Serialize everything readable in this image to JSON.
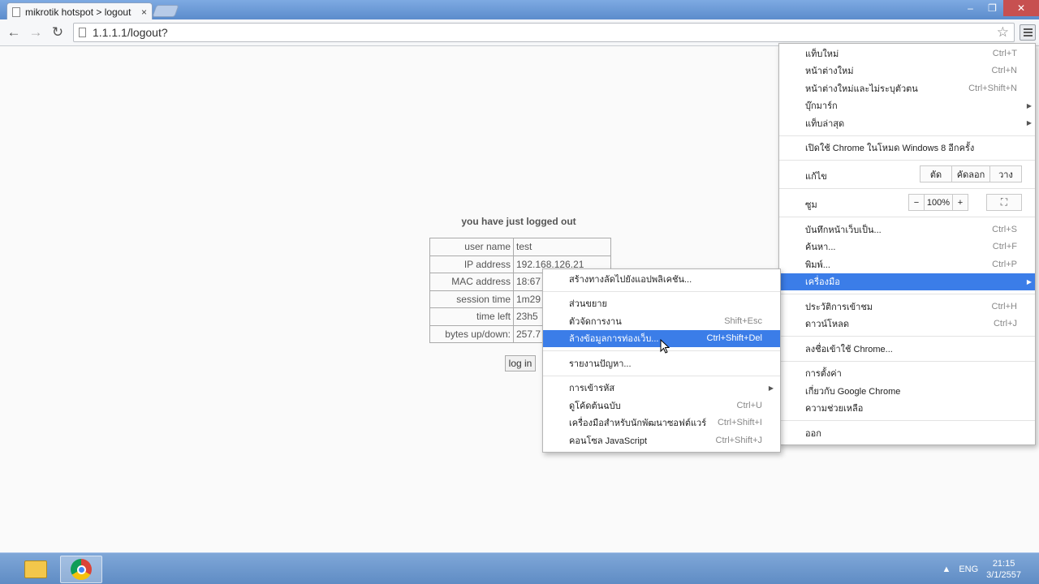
{
  "browser": {
    "tab_title": "mikrotik hotspot > logout",
    "tab_close": "×",
    "url": "1.1.1.1/logout?",
    "back_glyph": "←",
    "forward_glyph": "→",
    "reload_glyph": "↻",
    "star_glyph": "☆",
    "minimize_glyph": "–",
    "restore_glyph": "❐",
    "close_glyph": "✕"
  },
  "page": {
    "title": "you have just logged out",
    "rows": [
      {
        "label": "user name",
        "value": "test"
      },
      {
        "label": "IP address",
        "value": "192.168.126.21"
      },
      {
        "label": "MAC address",
        "value": "18:67"
      },
      {
        "label": "session time",
        "value": "1m29"
      },
      {
        "label": "time left",
        "value": "23h5"
      },
      {
        "label": "bytes up/down:",
        "value": "257.7"
      }
    ],
    "login_button": "log in"
  },
  "main_menu": {
    "new_tab": "แท็บใหม่",
    "new_tab_sc": "Ctrl+T",
    "new_window": "หน้าต่างใหม่",
    "new_window_sc": "Ctrl+N",
    "incognito": "หน้าต่างใหม่และไม่ระบุตัวตน",
    "incognito_sc": "Ctrl+Shift+N",
    "bookmarks": "บุ๊กมาร์ก",
    "recent_tabs": "แท็บล่าสุด",
    "win8_mode": "เปิดใช้ Chrome ในโหมด Windows 8 อีกครั้ง",
    "edit_label": "แก้ไข",
    "cut": "ตัด",
    "copy": "คัดลอก",
    "paste": "วาง",
    "zoom_label": "ซูม",
    "zoom_minus": "−",
    "zoom_value": "100%",
    "zoom_plus": "+",
    "fullscreen_glyph": "⛶",
    "save_as": "บันทึกหน้าเว็บเป็น...",
    "save_as_sc": "Ctrl+S",
    "find": "ค้นหา...",
    "find_sc": "Ctrl+F",
    "print": "พิมพ์...",
    "print_sc": "Ctrl+P",
    "tools": "เครื่องมือ",
    "history": "ประวัติการเข้าชม",
    "history_sc": "Ctrl+H",
    "downloads": "ดาวน์โหลด",
    "downloads_sc": "Ctrl+J",
    "sign_in": "ลงชื่อเข้าใช้ Chrome...",
    "settings": "การตั้งค่า",
    "about": "เกี่ยวกับ Google Chrome",
    "help": "ความช่วยเหลือ",
    "exit": "ออก",
    "arrow": "▶"
  },
  "tools_menu": {
    "create_shortcut": "สร้างทางลัดไปยังแอปพลิเคชัน...",
    "extensions": "ส่วนขยาย",
    "task_manager": "ตัวจัดการงาน",
    "task_manager_sc": "Shift+Esc",
    "clear_data": "ล้างข้อมูลการท่องเว็บ...",
    "clear_data_sc": "Ctrl+Shift+Del",
    "report_issue": "รายงานปัญหา...",
    "encoding": "การเข้ารหัส",
    "view_source": "ดูโค้ดต้นฉบับ",
    "view_source_sc": "Ctrl+U",
    "dev_tools": "เครื่องมือสำหรับนักพัฒนาซอฟต์แวร์",
    "dev_tools_sc": "Ctrl+Shift+I",
    "js_console": "คอนโซล JavaScript",
    "js_console_sc": "Ctrl+Shift+J",
    "arrow": "▶"
  },
  "taskbar": {
    "up_arrow": "▲",
    "lang": "ENG",
    "time": "21:15",
    "date": "3/1/2557"
  }
}
